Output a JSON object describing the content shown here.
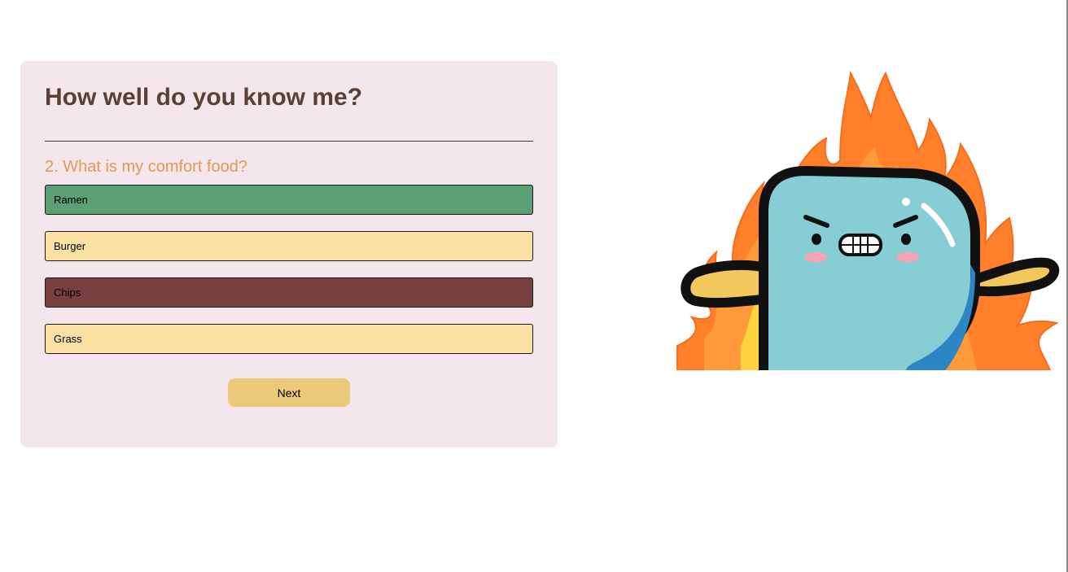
{
  "quiz": {
    "title": "How well do you know me?",
    "question": "2. What is my comfort food?",
    "answers": [
      {
        "label": "Ramen",
        "color": "#5aa074",
        "state": "correct"
      },
      {
        "label": "Burger",
        "color": "#fbe2a4",
        "state": "neutral"
      },
      {
        "label": "Chips",
        "color": "#784040",
        "state": "incorrect"
      },
      {
        "label": "Grass",
        "color": "#fbe2a4",
        "state": "neutral"
      }
    ],
    "next_label": "Next"
  },
  "colors": {
    "card_background": "#f3e6ec",
    "title_text": "#5a3f33",
    "question_text": "#df9a52",
    "correct_answer": "#5aa074",
    "incorrect_answer": "#784040",
    "neutral_answer": "#fbe2a4",
    "next_button": "#ebc97b"
  },
  "illustration": {
    "icon": "angry-blob-on-fire-icon"
  }
}
